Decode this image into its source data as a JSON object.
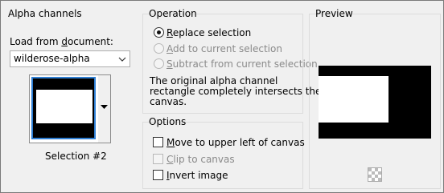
{
  "alpha": {
    "group_label": "Alpha channels",
    "load_label_prefix": "Load from ",
    "load_label_u": "d",
    "load_label_suffix": "ocument:",
    "document_value": "wilderose-alpha",
    "selection_caption": "Selection #2"
  },
  "operation": {
    "group_label": "Operation",
    "options": [
      {
        "u": "R",
        "rest": "eplace selection",
        "selected": true,
        "enabled": true
      },
      {
        "u": "A",
        "rest": "dd to current selection",
        "selected": false,
        "enabled": false
      },
      {
        "u": "S",
        "rest": "ubtract from current selection",
        "selected": false,
        "enabled": false
      }
    ],
    "description_line1": "The original alpha channel",
    "description_line2": "rectangle completely intersects the",
    "description_line3": "canvas."
  },
  "options": {
    "group_label": "Options",
    "checkboxes": [
      {
        "u": "M",
        "rest": "ove to upper left of canvas",
        "checked": false,
        "enabled": true
      },
      {
        "u": "C",
        "rest": "lip to canvas",
        "checked": false,
        "enabled": false
      },
      {
        "u": "I",
        "rest": "nvert image",
        "checked": false,
        "enabled": true
      }
    ]
  },
  "preview": {
    "group_label": "Preview"
  }
}
